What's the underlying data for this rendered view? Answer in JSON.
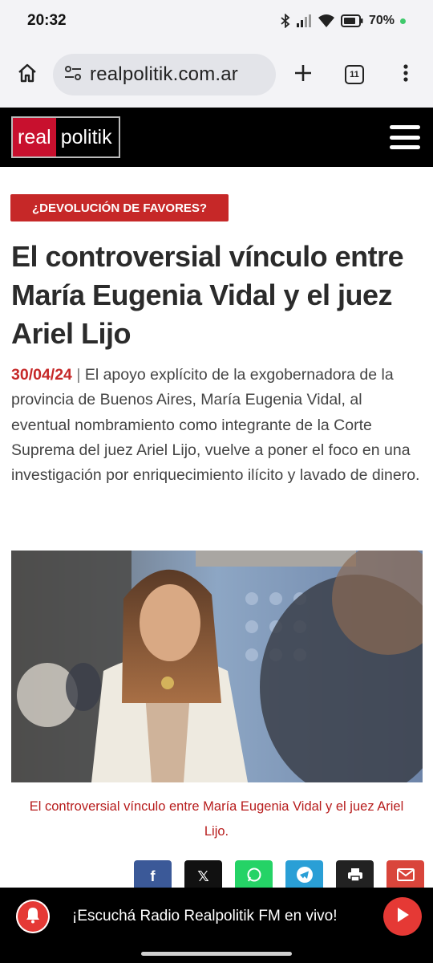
{
  "status_bar": {
    "time": "20:32",
    "battery": "70%",
    "icons": [
      "bluetooth-icon",
      "signal-icon",
      "wifi-icon",
      "battery-icon"
    ]
  },
  "browser": {
    "url": "realpolitik.com.ar",
    "tab_count": "11",
    "icons": [
      "home-icon",
      "site-settings-icon",
      "new-tab-icon",
      "tabs-icon",
      "menu-icon"
    ]
  },
  "site": {
    "logo_part1": "real",
    "logo_part2": "politik",
    "brand_red": "#c8102e"
  },
  "article": {
    "tag": "¿DEVOLUCIÓN DE FAVORES?",
    "headline": "El controversial vínculo entre María Eugenia Vidal y el juez Ariel Lijo",
    "date": "30/04/24",
    "separator": "|",
    "lead": "El apoyo explícito de la exgobernadora de la provincia de Buenos Aires, María Eugenia Vidal, al eventual nombramiento como integrante de la Corte Suprema del juez Ariel Lijo, vuelve a poner el foco en una investigación por enriquecimiento ilícito y lavado de dinero.",
    "caption": "El controversial vínculo entre María Eugenia Vidal y el juez Ariel Lijo."
  },
  "share": [
    {
      "name": "facebook",
      "label": "f",
      "color": "#3b5998"
    },
    {
      "name": "x",
      "label": "𝕏",
      "color": "#111111"
    },
    {
      "name": "whatsapp",
      "label": "",
      "color": "#25d366"
    },
    {
      "name": "telegram",
      "label": "",
      "color": "#2a9fd6"
    },
    {
      "name": "print",
      "label": "",
      "color": "#222222"
    },
    {
      "name": "email",
      "label": "",
      "color": "#d9453b"
    }
  ],
  "radio": {
    "text": "¡Escuchá Radio Realpolitik FM en vivo!",
    "accent": "#e53935"
  }
}
